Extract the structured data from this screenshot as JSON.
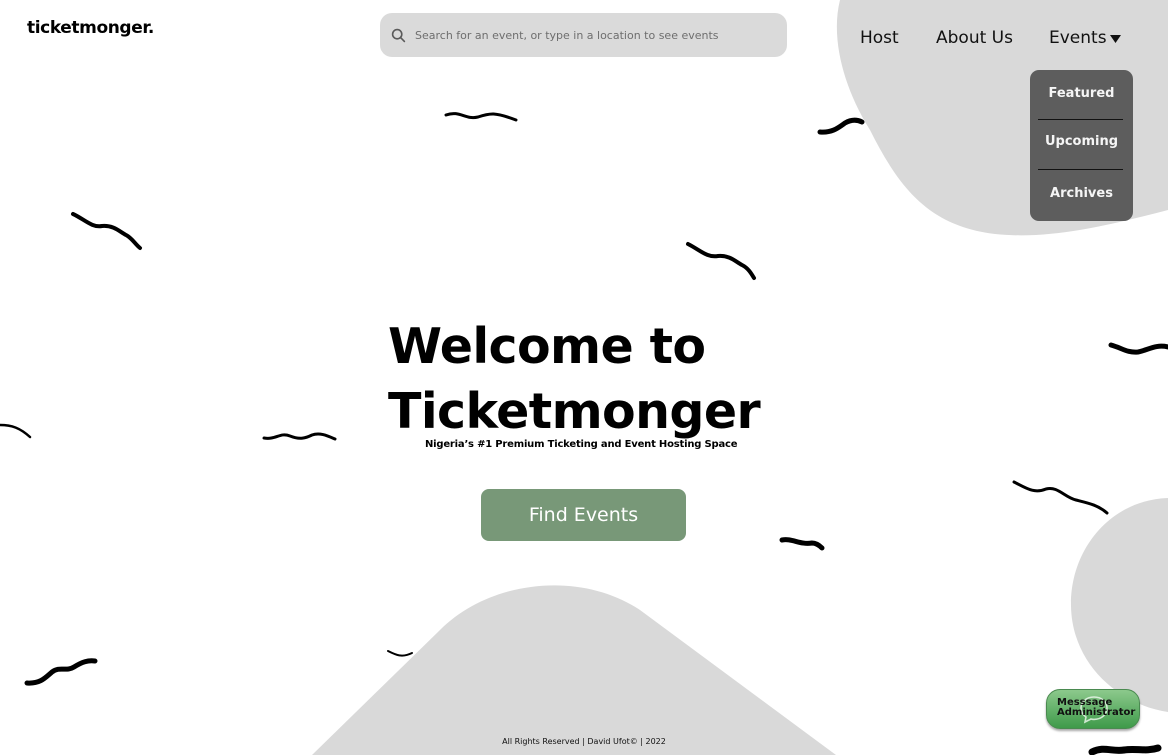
{
  "brand": {
    "logo_text": "ticketmonger."
  },
  "search": {
    "placeholder": "Search for an event, or type in a location to see events",
    "icon": "search-icon"
  },
  "nav": {
    "host": "Host",
    "about": "About Us",
    "events": "Events",
    "events_icon": "caret-down-icon"
  },
  "events_menu": {
    "items": [
      "Featured",
      "Upcoming",
      "Archives"
    ]
  },
  "hero": {
    "title_line1": "Welcome to",
    "title_line2": "Ticketmonger",
    "tagline": "Nigeria’s #1 Premium Ticketing and Event Hosting Space",
    "cta": "Find Events"
  },
  "footer": {
    "text": "All Rights Reserved | David Ufot© | 2022"
  },
  "message_button": {
    "label": "Messsage\nAdministrator",
    "icon": "chat-bubble-icon"
  },
  "colors": {
    "background": "#ffffff",
    "blob": "#d9d9d9",
    "dropdown_bg": "#5d5d5d",
    "cta": "#789878",
    "message_button": "#5fb062"
  }
}
